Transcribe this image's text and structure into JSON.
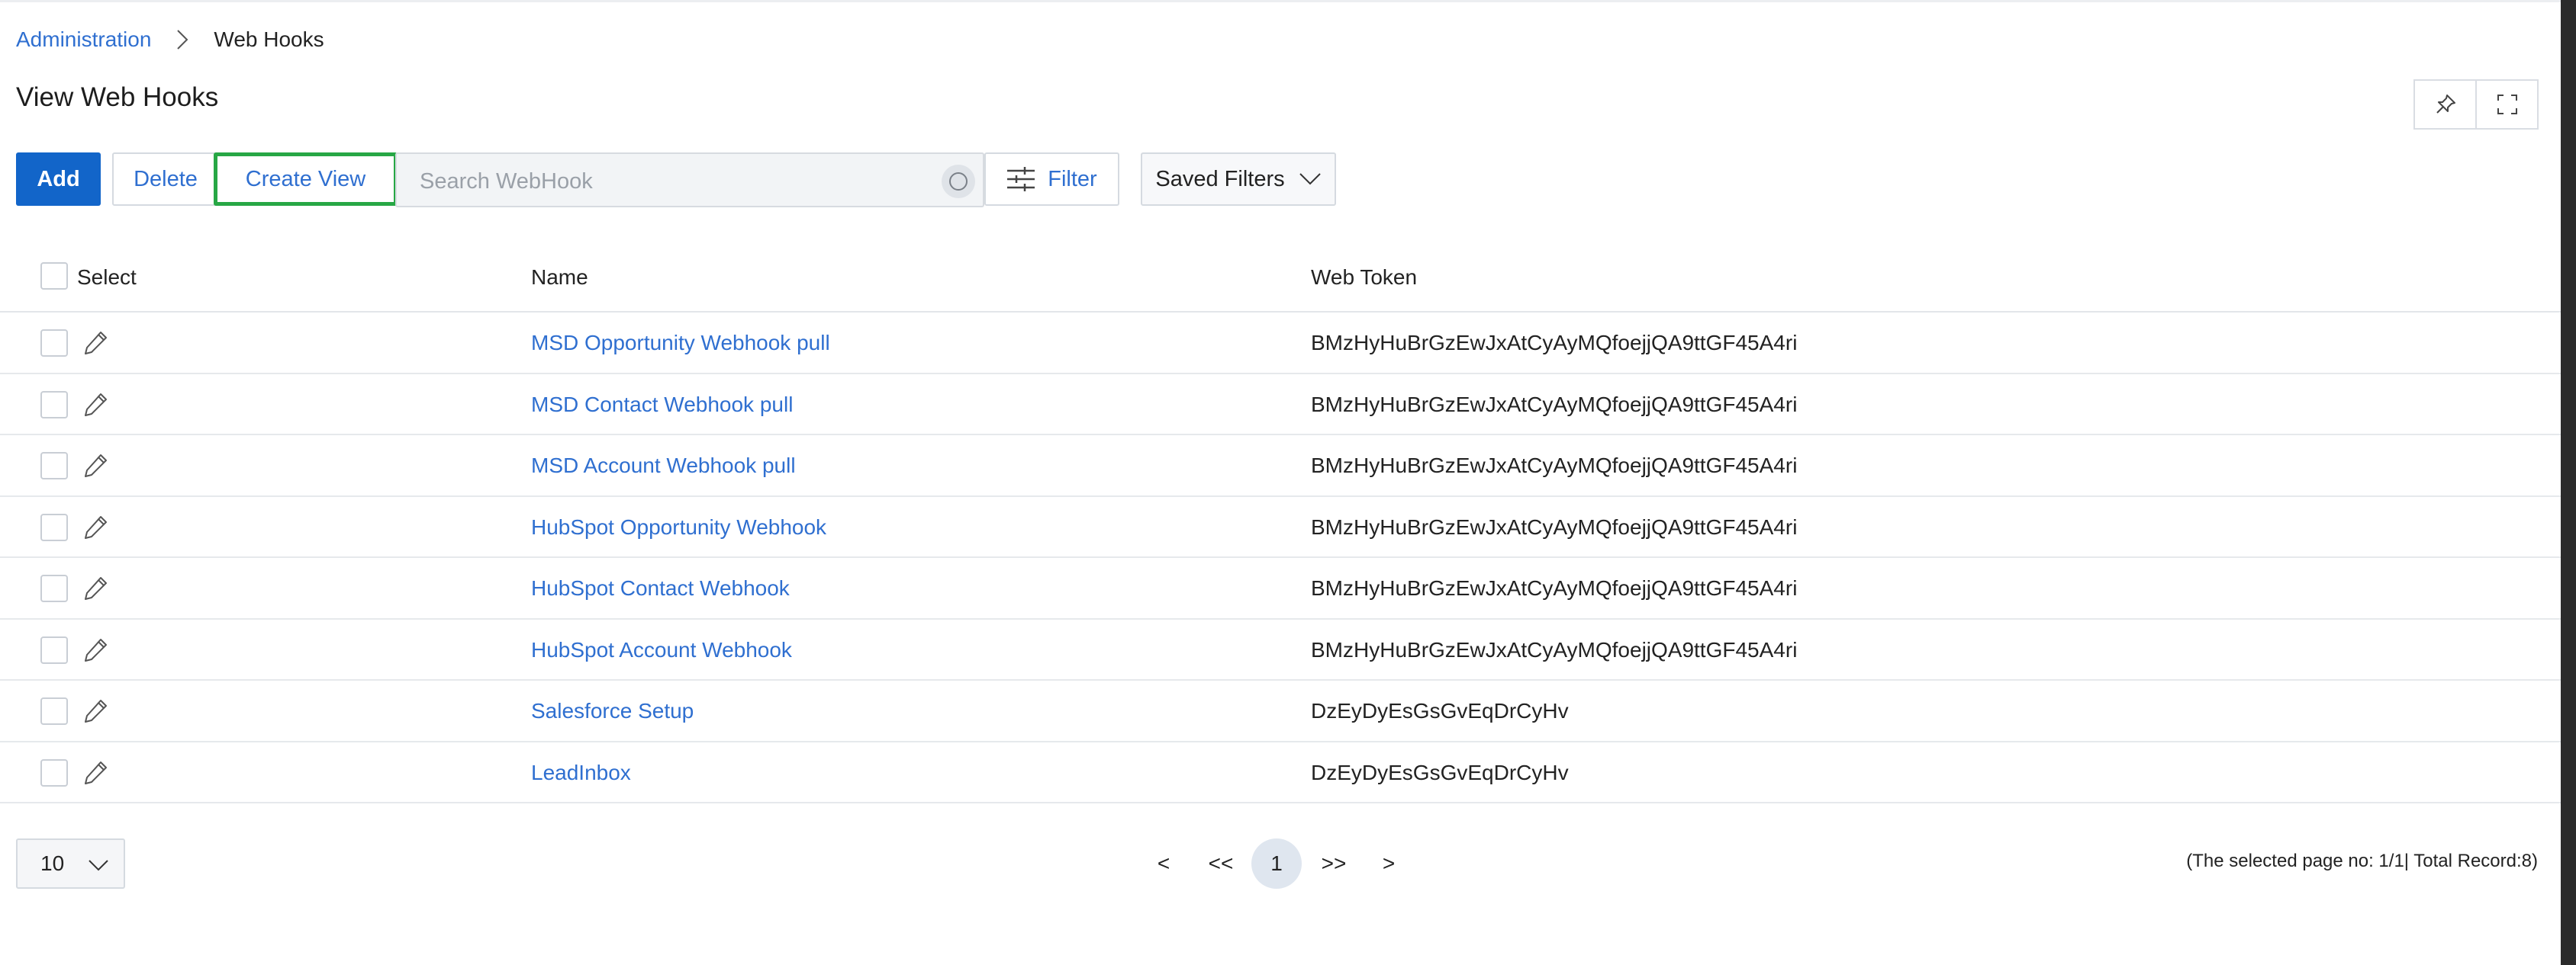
{
  "breadcrumb": {
    "parent": "Administration",
    "current": "Web Hooks"
  },
  "page": {
    "title": "View Web Hooks"
  },
  "toolbar": {
    "add_label": "Add",
    "delete_label": "Delete",
    "create_view_label": "Create View",
    "search_placeholder": "Search WebHook",
    "filter_label": "Filter",
    "saved_filters_label": "Saved Filters"
  },
  "table": {
    "headers": {
      "select": "Select",
      "name": "Name",
      "token": "Web Token"
    },
    "rows": [
      {
        "name": "MSD Opportunity Webhook pull",
        "token": "BMzHyHuBrGzEwJxAtCyAyMQfoejjQA9ttGF45A4ri"
      },
      {
        "name": "MSD Contact Webhook pull",
        "token": "BMzHyHuBrGzEwJxAtCyAyMQfoejjQA9ttGF45A4ri"
      },
      {
        "name": "MSD Account Webhook pull",
        "token": "BMzHyHuBrGzEwJxAtCyAyMQfoejjQA9ttGF45A4ri"
      },
      {
        "name": "HubSpot Opportunity Webhook",
        "token": "BMzHyHuBrGzEwJxAtCyAyMQfoejjQA9ttGF45A4ri"
      },
      {
        "name": "HubSpot Contact Webhook",
        "token": "BMzHyHuBrGzEwJxAtCyAyMQfoejjQA9ttGF45A4ri"
      },
      {
        "name": "HubSpot Account Webhook",
        "token": "BMzHyHuBrGzEwJxAtCyAyMQfoejjQA9ttGF45A4ri"
      },
      {
        "name": "Salesforce Setup",
        "token": "DzEyDyEsGsGvEqDrCyHv"
      },
      {
        "name": "LeadInbox",
        "token": "DzEyDyEsGsGvEqDrCyHv"
      }
    ]
  },
  "pagination": {
    "page_size": "10",
    "prev": "<",
    "first": "<<",
    "current": "1",
    "last": ">>",
    "next": ">",
    "info": "(The selected page no: 1/1| Total Record:8)"
  },
  "icons": {
    "breadcrumb_separator": "chevron-right-icon",
    "pin": "pin-icon",
    "fullscreen": "fullscreen-icon",
    "search": "search-icon",
    "filter": "sliders-icon",
    "saved_filters": "chevron-down-icon",
    "row_edit": "pencil-icon",
    "page_size": "chevron-down-icon"
  },
  "colors": {
    "primary": "#1265c9",
    "link": "#2f6fd0",
    "highlight_border": "#27a745"
  }
}
